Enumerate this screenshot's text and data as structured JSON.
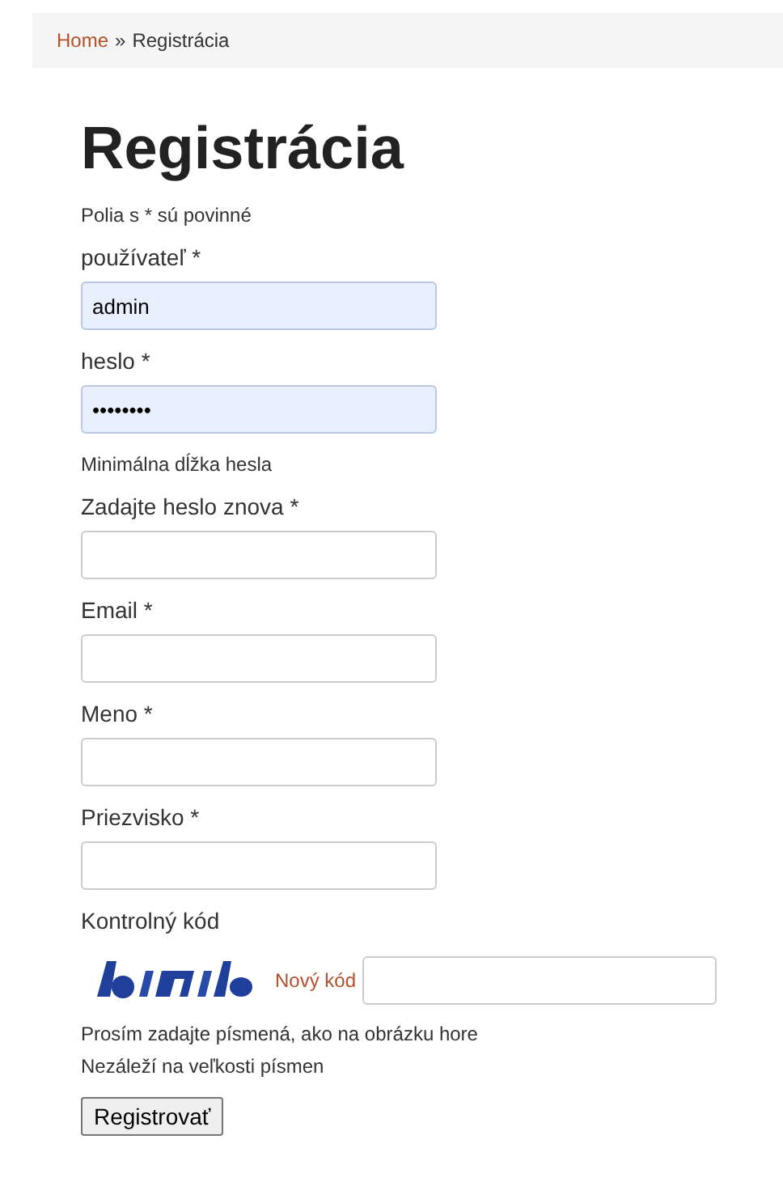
{
  "breadcrumb": {
    "home": "Home",
    "separator": "»",
    "current": "Registrácia"
  },
  "title": "Registrácia",
  "required_note": "Polia s * sú povinné",
  "fields": [
    {
      "label": "používateľ *",
      "value": "admin",
      "autofilled": true
    },
    {
      "label": "heslo *",
      "value": "••••••••",
      "autofilled": true,
      "hint": "Minimálna dĺžka hesla"
    },
    {
      "label": "Zadajte heslo znova *",
      "autofilled": false
    },
    {
      "label": "Email *",
      "autofilled": false
    },
    {
      "label": "Meno *",
      "autofilled": false
    },
    {
      "label": "Priezvisko *",
      "autofilled": false
    }
  ],
  "captcha": {
    "label": "Kontrolný kód",
    "new_code_link": "Nový kód",
    "help": [
      "Prosím zadajte písmená, ako na obrázku hore",
      "Nezáleží na veľkosti písmen"
    ]
  },
  "submit": "Registrovať"
}
